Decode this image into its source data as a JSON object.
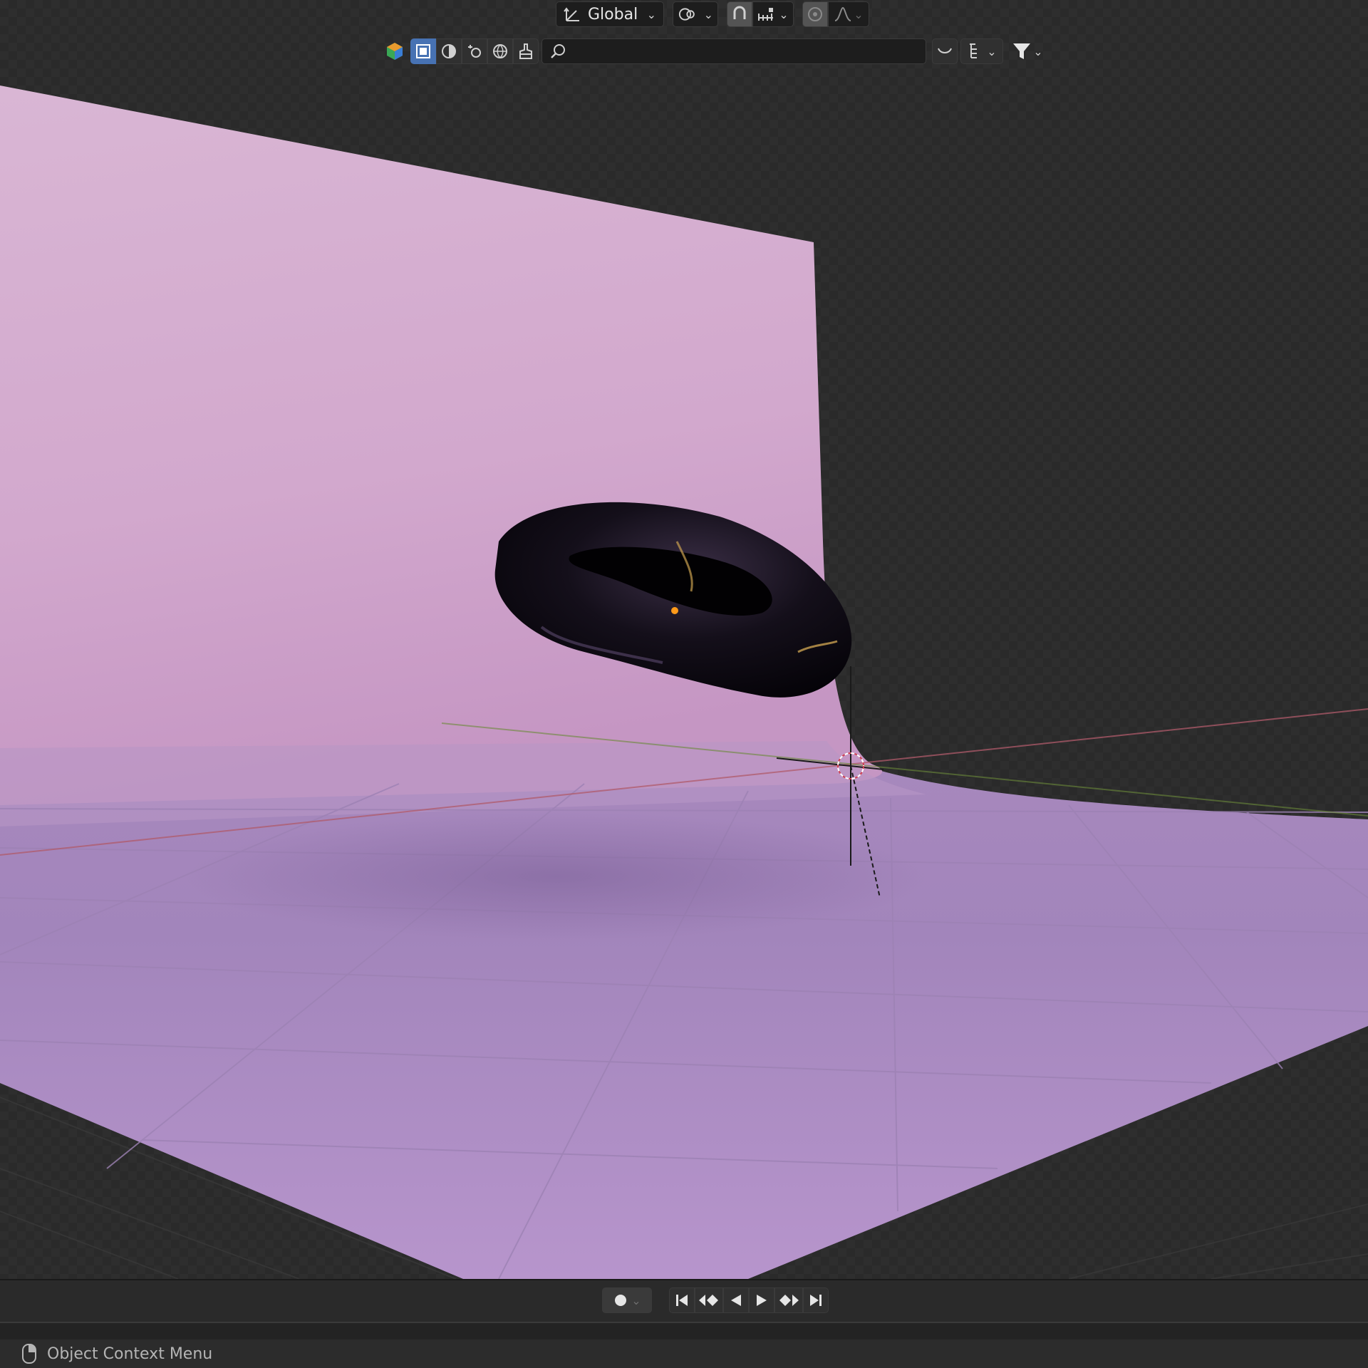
{
  "header": {
    "transform_orientation": "Global",
    "search": {
      "value": "",
      "placeholder": ""
    }
  },
  "viewport": {
    "scene_objects": [
      "backdrop-plane",
      "torus",
      "3d-cursor",
      "floor-grid"
    ],
    "colors": {
      "backdrop_top": "#d8b4d3",
      "backdrop_bottom": "#c89ac2",
      "floor": "#b190c8",
      "torus": "#0e0a12",
      "x_axis": "#b05050",
      "y_axis": "#6a8a3a",
      "origin_dot": "#ff9a1a"
    }
  },
  "timeline": {
    "record_icon": "record-icon",
    "playback_icons": [
      "jump-start-icon",
      "prev-keyframe-icon",
      "play-reverse-icon",
      "play-icon",
      "next-keyframe-icon",
      "jump-end-icon"
    ]
  },
  "statusbar": {
    "mouse_icon": "mouse-right-icon",
    "text": "Object Context Menu"
  },
  "colors": {
    "accent": "#4772b3",
    "header_bg": "#2b2b2b"
  }
}
